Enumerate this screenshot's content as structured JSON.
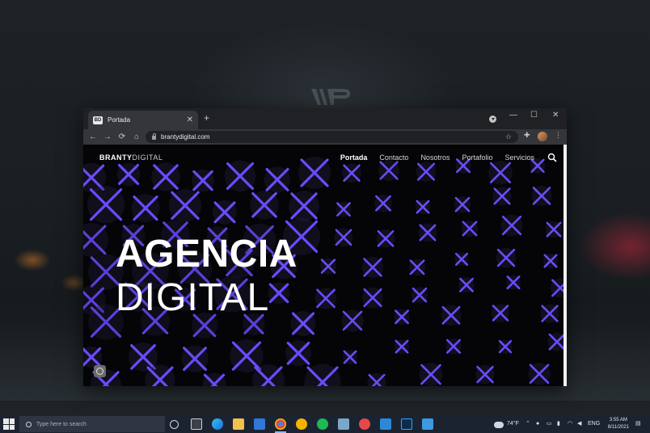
{
  "browser": {
    "tab": {
      "favicon_text": "BD",
      "title": "Portada",
      "close_glyph": "✕"
    },
    "new_tab_glyph": "+",
    "window_controls": {
      "minimize": "—",
      "maximize": "☐",
      "close": "✕"
    },
    "toolbar": {
      "back": "←",
      "forward": "→",
      "reload": "⟳",
      "home": "⌂",
      "url": "brantydigital.com",
      "bookmark": "☆",
      "extensions": "✚",
      "menu": "⋮"
    }
  },
  "site": {
    "logo_bold": "BRANTY",
    "logo_light": "DIGITAL",
    "nav": [
      {
        "label": "Portada",
        "active": true
      },
      {
        "label": "Contacto",
        "active": false
      },
      {
        "label": "Nosotros",
        "active": false
      },
      {
        "label": "Portafolio",
        "active": false
      },
      {
        "label": "Servicios",
        "active": false
      }
    ],
    "hero": {
      "line1": "AGENCIA",
      "line2": "DIGITAL"
    },
    "pattern_color": "#6a4bff",
    "background_color": "#050407"
  },
  "taskbar": {
    "search_placeholder": "Type here to search",
    "weather": "74°F",
    "language": "ENG",
    "time": "3:55 AM",
    "date": "8/11/2021",
    "background_color": "#1c2330"
  }
}
